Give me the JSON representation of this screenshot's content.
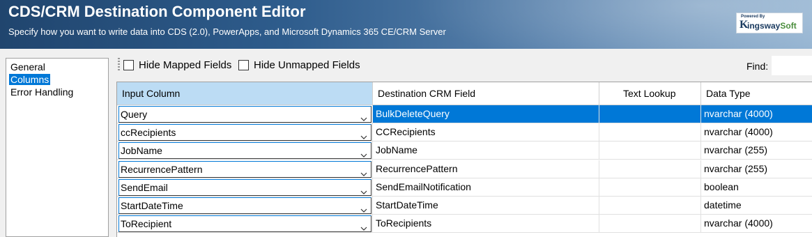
{
  "header": {
    "title": "CDS/CRM Destination Component Editor",
    "subtitle": "Specify how you want to write data into CDS (2.0), PowerApps, and Microsoft Dynamics 365 CE/CRM Server",
    "logo_powered_by": "Powered By",
    "logo_k": "K",
    "logo_ingsway": "ingsway",
    "logo_soft": "Soft"
  },
  "nav": {
    "items": [
      {
        "label": "General"
      },
      {
        "label": "Columns"
      },
      {
        "label": "Error Handling"
      }
    ],
    "selected": "Columns"
  },
  "toolbar": {
    "hide_mapped_label": "Hide Mapped Fields",
    "hide_unmapped_label": "Hide Unmapped Fields",
    "find_label": "Find:",
    "find_value": ""
  },
  "grid": {
    "columns": [
      "Input Column",
      "Destination CRM Field",
      "Text Lookup",
      "Data Type"
    ],
    "rows": [
      {
        "input": "Query",
        "dest": "BulkDeleteQuery",
        "lookup": "",
        "type": "nvarchar (4000)"
      },
      {
        "input": "ccRecipients",
        "dest": "CCRecipients",
        "lookup": "",
        "type": "nvarchar (4000)"
      },
      {
        "input": "JobName",
        "dest": "JobName",
        "lookup": "",
        "type": "nvarchar (255)"
      },
      {
        "input": "RecurrencePattern",
        "dest": "RecurrencePattern",
        "lookup": "",
        "type": "nvarchar (255)"
      },
      {
        "input": "SendEmail",
        "dest": "SendEmailNotification",
        "lookup": "",
        "type": "boolean"
      },
      {
        "input": "StartDateTime",
        "dest": "StartDateTime",
        "lookup": "",
        "type": "datetime"
      },
      {
        "input": "ToRecipient",
        "dest": "ToRecipients",
        "lookup": "",
        "type": "nvarchar (4000)"
      }
    ],
    "selected_row": 0
  },
  "colors": {
    "selection": "#0078d7",
    "header_selected": "#bcdcf4"
  }
}
